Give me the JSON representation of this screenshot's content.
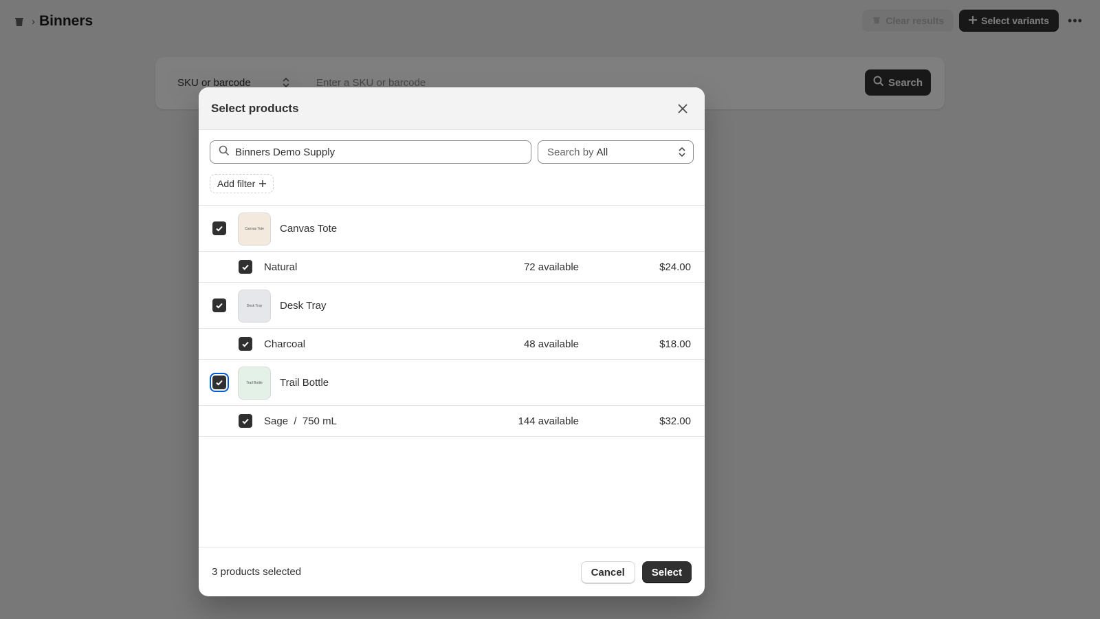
{
  "page": {
    "breadcrumb_icon": "inventory-bin-icon",
    "title": "Binners",
    "clear_results_label": "Clear results",
    "select_variants_label": "Select variants",
    "more_icon": "ellipsis-icon"
  },
  "lookup": {
    "mode_value": "SKU or barcode",
    "input_placeholder": "Enter a SKU or barcode",
    "search_label": "Search"
  },
  "modal": {
    "title": "Select products",
    "close_icon": "close-icon",
    "query_value": "Binners Demo Supply",
    "search_by_label": "Search by",
    "search_by_value": "All",
    "add_filter_label": "Add filter",
    "products": [
      {
        "name": "Canvas Tote",
        "thumb_text": "Canvas Tote",
        "thumb_color": "#f3e9dc",
        "checked": true,
        "variant": {
          "name": "Natural",
          "available": "72 available",
          "price": "$24.00",
          "checked": true
        }
      },
      {
        "name": "Desk Tray",
        "thumb_text": "Desk Tray",
        "thumb_color": "#e6e7eb",
        "checked": true,
        "variant": {
          "name": "Charcoal",
          "available": "48 available",
          "price": "$18.00",
          "checked": true
        }
      },
      {
        "name": "Trail Bottle",
        "thumb_text": "Trail Bottle",
        "thumb_color": "#e3f1e7",
        "checked": true,
        "variant": {
          "name": "Sage  /  750 mL",
          "available": "144 available",
          "price": "$32.00",
          "checked": true
        }
      }
    ],
    "selected_count": "3 products selected",
    "cancel_label": "Cancel",
    "select_label": "Select"
  },
  "colors": {
    "primary_dark": "#303030",
    "focus_ring": "#005bd3",
    "backdrop": "rgba(0,0,0,0.5)"
  }
}
